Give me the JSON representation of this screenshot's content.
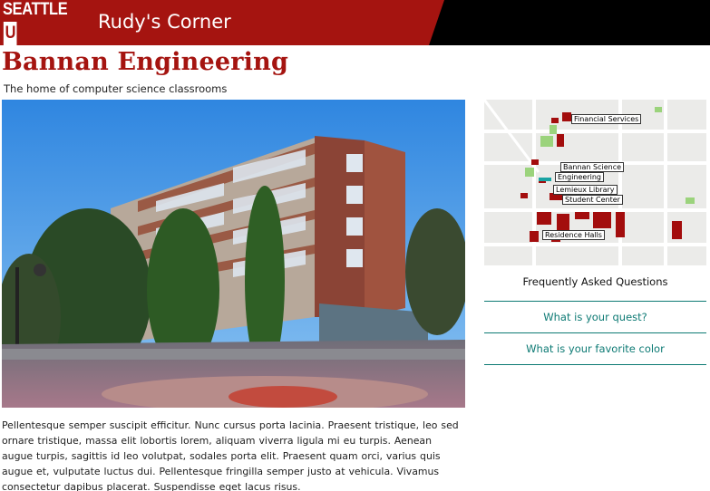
{
  "header": {
    "logo_main": "SEATTLE",
    "logo_box": "U",
    "site_title": "Rudy's Corner"
  },
  "page": {
    "title": "Bannan Engineering",
    "subtitle": "The home of computer science classrooms",
    "body": "Pellentesque semper suscipit efficitur. Nunc cursus porta lacinia. Praesent tristique, leo sed ornare tristique, massa elit lobortis lorem, aliquam viverra ligula mi eu turpis. Aenean augue turpis, sagittis id leo volutpat, sodales porta elit. Praesent quam orci, varius quis augue et, vulputate luctus dui. Pellentesque fringilla semper justo at vehicula. Vivamus consectetur dapibus placerat. Suspendisse eget lacus risus."
  },
  "map": {
    "labels": {
      "financial": "Financial Services",
      "bannan_science": "Bannan Science",
      "engineering": "Engineering",
      "lemieux": "Lemieux Library",
      "student_center": "Student Center",
      "residence": "Residence Halls"
    },
    "building_color": "#a30d0d",
    "green_color": "#9bd37c"
  },
  "faq": {
    "title": "Frequently Asked Questions",
    "items": [
      "What is your quest?",
      "What is your favorite color"
    ]
  },
  "colors": {
    "brand_red": "#a51410",
    "header_black": "#000000",
    "accent_teal": "#0d7a74"
  }
}
